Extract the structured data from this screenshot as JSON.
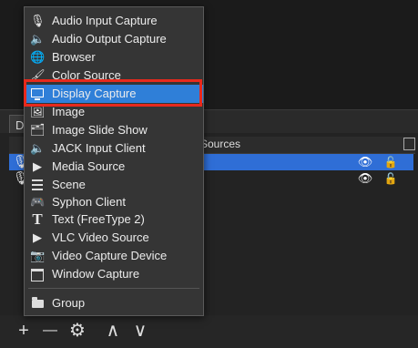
{
  "background": {
    "tab_label": "De",
    "panel_header": "Sources"
  },
  "menu": {
    "items": [
      {
        "label": "Audio Input Capture",
        "icon": "microphone-icon"
      },
      {
        "label": "Audio Output Capture",
        "icon": "speaker-icon"
      },
      {
        "label": "Browser",
        "icon": "globe-icon"
      },
      {
        "label": "Color Source",
        "icon": "brush-icon"
      },
      {
        "label": "Display Capture",
        "icon": "monitor-icon"
      },
      {
        "label": "Image",
        "icon": "image-icon"
      },
      {
        "label": "Image Slide Show",
        "icon": "slideshow-icon"
      },
      {
        "label": "JACK Input Client",
        "icon": "speaker-icon"
      },
      {
        "label": "Media Source",
        "icon": "play-icon"
      },
      {
        "label": "Scene",
        "icon": "list-icon"
      },
      {
        "label": "Syphon Client",
        "icon": "gamepad-icon"
      },
      {
        "label": "Text (FreeType 2)",
        "icon": "text-icon"
      },
      {
        "label": "VLC Video Source",
        "icon": "play-icon"
      },
      {
        "label": "Video Capture Device",
        "icon": "camera-icon"
      },
      {
        "label": "Window Capture",
        "icon": "window-icon"
      },
      {
        "label": "Group",
        "icon": "folder-icon"
      }
    ],
    "highlighted": "Display Capture",
    "highlight_color": "#2f7fd8",
    "callout_color": "#e8291c"
  },
  "toolbar": {
    "add": "+",
    "remove": "—",
    "settings": "⚙",
    "up": "∧",
    "down": "∨"
  }
}
